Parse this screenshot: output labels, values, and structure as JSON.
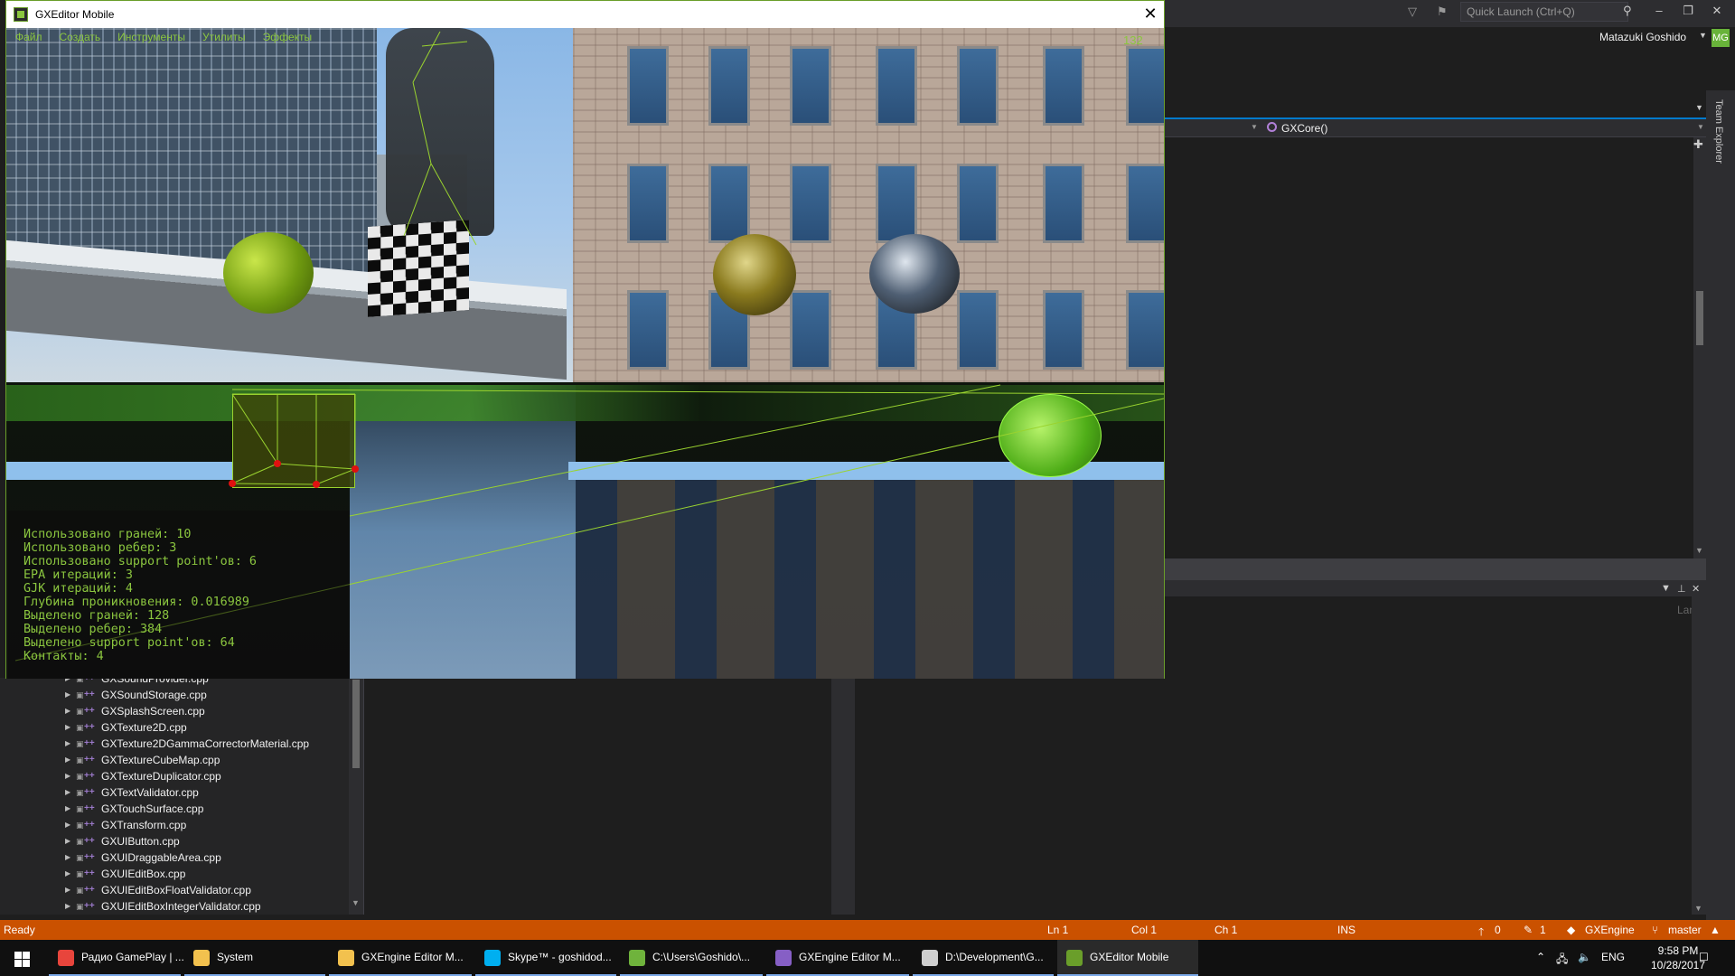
{
  "vs": {
    "quick_launch_placeholder": "Quick Launch (Ctrl+Q)",
    "user_name": "Matazuki Goshido",
    "user_initials": "MG",
    "function_nav": "GXCore()",
    "team_explorer": "Team Explorer",
    "output_lang": "Lang"
  },
  "solution_files": [
    "GXSoundProvider.cpp",
    "GXSoundStorage.cpp",
    "GXSplashScreen.cpp",
    "GXTexture2D.cpp",
    "GXTexture2DGammaCorrectorMaterial.cpp",
    "GXTextureCubeMap.cpp",
    "GXTextureDuplicator.cpp",
    "GXTextValidator.cpp",
    "GXTouchSurface.cpp",
    "GXTransform.cpp",
    "GXUIButton.cpp",
    "GXUIDraggableArea.cpp",
    "GXUIEditBox.cpp",
    "GXUIEditBoxFloatValidator.cpp",
    "GXUIEditBoxIntegerValidator.cpp"
  ],
  "status": {
    "ready": "Ready",
    "line": "Ln 1",
    "col": "Col 1",
    "ch": "Ch 1",
    "mode": "INS",
    "pushes": "0",
    "edits": "1",
    "repo": "GXEngine",
    "branch": "master"
  },
  "taskbar": {
    "items": [
      {
        "label": "Радио GamePlay | ...",
        "icon": "chrome-icon",
        "color": "#e8453c"
      },
      {
        "label": "System",
        "icon": "folder-icon",
        "color": "#f2c14e"
      },
      {
        "label": "GXEngine Editor M...",
        "icon": "folder-icon",
        "color": "#f2c14e"
      },
      {
        "label": "Skype™ - goshidod...",
        "icon": "skype-icon",
        "color": "#00aff0"
      },
      {
        "label": "C:\\Users\\Goshido\\...",
        "icon": "notepad-icon",
        "color": "#6fb33c"
      },
      {
        "label": "GXEngine Editor M...",
        "icon": "visual-studio-icon",
        "color": "#865fc5"
      },
      {
        "label": "D:\\Development\\G...",
        "icon": "console-icon",
        "color": "#cfcfcf"
      },
      {
        "label": "GXEditor Mobile",
        "icon": "gx-editor-icon",
        "color": "#6a9e2a"
      }
    ],
    "language": "ENG",
    "time": "9:58 PM",
    "date": "10/28/2017"
  },
  "gx": {
    "title": "GXEditor Mobile",
    "menu": [
      "Файл",
      "Создать",
      "Инструменты",
      "Утилиты",
      "Эффекты"
    ],
    "fps": "132",
    "stats": [
      "Использовано граней: 10",
      "Использовано ребер: 3",
      "Использовано support point'ов: 6",
      "EPA итераций: 3",
      "GJK итераций: 4",
      "Глубина проникновения: 0.016989",
      "Выделено граней: 128",
      "Выделено ребер: 384",
      "Выделено support point'ов: 64",
      "Контакты: 4"
    ],
    "accent": "#8bc63f"
  }
}
